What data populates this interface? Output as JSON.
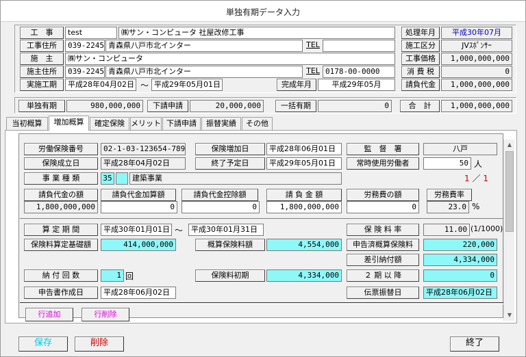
{
  "window": {
    "title": "単独有期データ入力"
  },
  "header": {
    "koji_label": "工　事",
    "koji_code": "test",
    "koji_name": "㈱サン・コンピュータ 社屋改修工事",
    "koji_jusho_label": "工事住所",
    "koji_zip": "039-2245",
    "koji_address": "青森県八戸市北インター",
    "koji_tel_label": "TEL",
    "koji_tel": "",
    "sesyu_label": "施　主",
    "sesyu_name": "㈱サン・コンピュータ",
    "sesyu_jusho_label": "施主住所",
    "sesyu_zip": "039-2245",
    "sesyu_address": "青森県八戸市北インター",
    "sesyu_tel_label": "TEL",
    "sesyu_tel": "0178-00-0000",
    "jisshi_label": "実施工期",
    "jisshi_from": "平成28年04月02日",
    "jisshi_tilde": "〜",
    "jisshi_to": "平成29年05月01日",
    "kansei_label": "完成年月",
    "kansei_value": "平成29年05月",
    "shori_label": "処理年月",
    "shori_value": "平成30年07月",
    "seko_kubun_label": "施工区分",
    "seko_kubun_value": "JVｽﾎﾟﾝｻｰ",
    "koji_kakaku_label": "工事価格",
    "koji_kakaku_value": "1,000,000,000",
    "shohizei_label": "消 費 税",
    "shohizei_value": "0",
    "ukeoi_label": "請負代金",
    "ukeoi_value": "1,000,000,000",
    "tandoku_label": "単独有期",
    "tandoku_value": "980,000,000",
    "shitauke_label": "下請申請",
    "shitauke_value": "20,000,000",
    "ikkatsu_label": "一括有期",
    "ikkatsu_value": "0",
    "gokei_label": "合　計",
    "gokei_value": "1,000,000,000"
  },
  "tabs": [
    {
      "label": "当初概算",
      "active": false
    },
    {
      "label": "増加概算",
      "active": true
    },
    {
      "label": "確定保険",
      "active": false
    },
    {
      "label": "メリット",
      "active": false
    },
    {
      "label": "下請申請",
      "active": false
    },
    {
      "label": "振替実績",
      "active": false
    },
    {
      "label": "その他",
      "active": false
    }
  ],
  "form": {
    "rodo_hoken_bango_label": "労働保険番号",
    "rodo_hoken_bango": "02-1-03-123654-789",
    "hoken_zoka_bi_label": "保険増加日",
    "hoken_zoka_bi": "平成28年06月01日",
    "kantoku_sho_label": "監　督　署",
    "kantoku_sho": "八戸",
    "hoken_seiritsu_label": "保険成立日",
    "hoken_seiritsu": "平成28年04月02日",
    "shuryo_yotei_label": "終了予定日",
    "shuryo_yotei": "平成29年05月01日",
    "joji_rodosha_label": "常時使用労働者",
    "joji_rodosha": "50",
    "joji_unit": "人",
    "page_current": "1",
    "page_sep": "／",
    "page_total": "1",
    "jigyo_shurui_label": "事 業 種 類",
    "jigyo_code": "35",
    "jigyo_name": "建築事業",
    "col_headers": [
      "請負代金の額",
      "請負代金加算額",
      "請負代金控除額",
      "請 負 金 額",
      "労務費の額",
      "労務費率"
    ],
    "col_values": [
      "1,800,000,000",
      "0",
      "0",
      "1,800,000,000",
      "0",
      "23.0"
    ],
    "percent": "%",
    "santei_kikan_label": "算 定 期 間",
    "santei_from": "平成30年01月01日",
    "santei_tilde": "〜",
    "santei_to": "平成30年01月31日",
    "hokenryo_ritsu_label": "保 険 料 率",
    "hokenryo_ritsu": "11.00",
    "hokenryo_ritsu_unit": "(1/1000)",
    "santei_kiso_label": "保険料算定基礎額",
    "santei_kiso": "414,000,000",
    "gaisan_label": "概算保険料額",
    "gaisan": "4,554,000",
    "shinkoku_zumi_label": "申告済概算保険料",
    "shinkoku_zumi": "220,000",
    "sashihiki_label": "差引納付額",
    "sashihiki": "4,334,000",
    "nofu_kaisu_label": "納 付 回 数",
    "nofu_kaisu": "1",
    "nofu_unit": "回",
    "shoki_label": "保険料初期",
    "shoki": "4,334,000",
    "niki_label": "２ 期 以 降",
    "niki": "0",
    "shinkokusho_label": "申告書作成日",
    "shinkokusho": "平成28年06月02日",
    "denpyo_label": "伝票振替日",
    "denpyo": "平成28年06月02日",
    "row_add_label": "行追加",
    "row_del_label": "行削除"
  },
  "footer": {
    "save_label": "保存",
    "delete_label": "削除",
    "close_label": "終了"
  },
  "colors": {
    "cyan": "#8ef8f8",
    "magenta_text": "#e000e0",
    "red_text": "#cc0000"
  }
}
